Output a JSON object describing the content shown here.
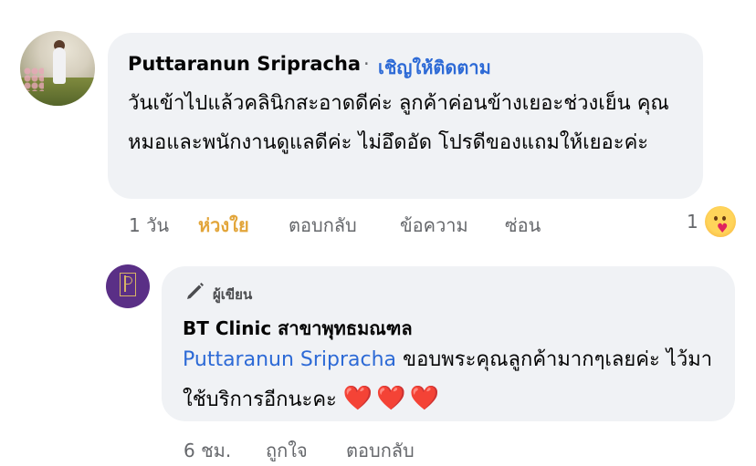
{
  "comment": {
    "author": "Puttaranun Sripracha",
    "separator": "·",
    "follow_label": "เชิญให้ติดตาม",
    "text": "วันเข้าไปแล้วคลินิกสะอาดดีค่ะ ลูกค้าค่อนข้างเยอะช่วงเย็น คุณหมอและพนักงานดูแลดีค่ะ ไม่อึดอัด โปรดีของแถมให้เยอะค่ะ",
    "time": "1 วัน",
    "like_label": "ห่วงใย",
    "reply_label": "ตอบกลับ",
    "message_label": "ข้อความ",
    "hide_label": "ซ่อน",
    "reaction_count": "1",
    "reaction_icon": "care-reaction-icon"
  },
  "reply": {
    "badge_label": "ผู้เขียน",
    "author": "BT Clinic สาขาพุทธมณฑล",
    "mention": "Puttaranun Sripracha",
    "text": " ขอบพระคุณลูกค้ามากๆเลยค่ะ ไว้มาใช้บริการอีกนะคะ ",
    "hearts": "❤️❤️❤️",
    "time": "6 ชม.",
    "like_label": "ถูกใจ",
    "reply_label": "ตอบกลับ"
  },
  "colors": {
    "bubble": "#f0f2f5",
    "link": "#2d6ad6",
    "care_reaction": "#e2a53a",
    "meta": "#65676b"
  }
}
